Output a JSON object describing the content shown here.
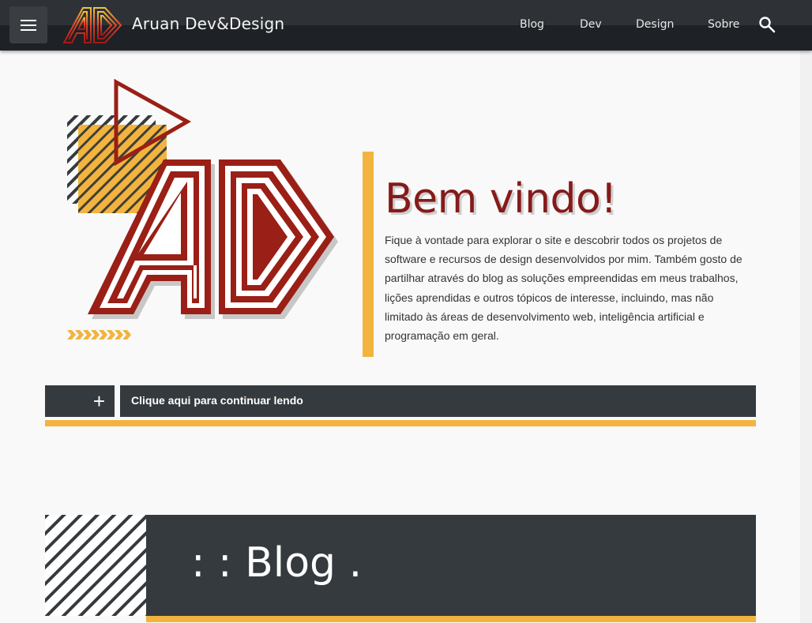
{
  "header": {
    "site_title": "Aruan Dev&Design",
    "logo_text": "AD",
    "nav": [
      {
        "label": "Blog"
      },
      {
        "label": "Dev"
      },
      {
        "label": "Design"
      },
      {
        "label": "Sobre"
      }
    ],
    "menu_icon": "hamburger-menu-icon",
    "search_icon": "search-icon"
  },
  "hero": {
    "title": "Bem vindo!",
    "text": "Fique à vontade para explorar o site e descobrir todos os projetos de software e recursos de design desenvolvidos por mim. Também gosto de partilhar através do blog as soluções empreendidas em meus trabalhos, lições aprendidas e outros tópicos de interesse, incluindo, mas não limitado às áreas de desenvolvimento web, inteligência artificial e programação em geral."
  },
  "read_more": {
    "icon_label": "+",
    "label": "Clique aqui para continuar lendo"
  },
  "blog_section": {
    "title": ": : Blog ."
  },
  "colors": {
    "accent_yellow": "#f2b43f",
    "brand_red": "#861a1a",
    "dark": "#343a3e",
    "background": "#f9f9f9"
  }
}
